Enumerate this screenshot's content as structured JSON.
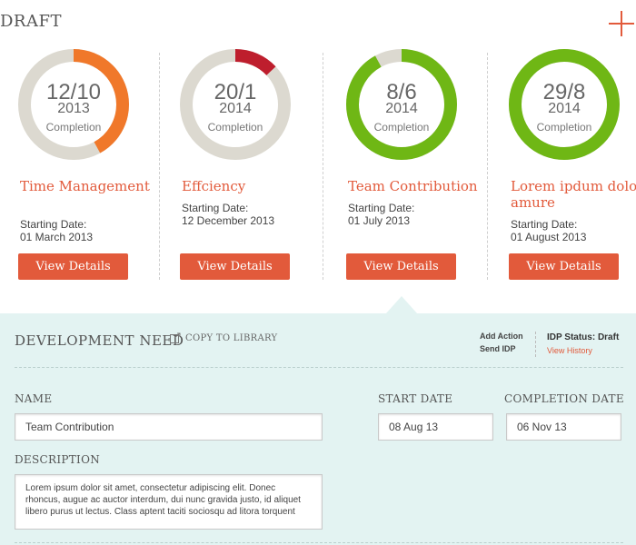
{
  "header": {
    "title": "DRAFT",
    "add_icon": "plus-icon"
  },
  "cards": [
    {
      "date": "12/10",
      "year": "2013",
      "completion_label": "Completion",
      "progress": 0.42,
      "progress_color": "#f0782a",
      "title": "Time Management",
      "start_label": "Starting Date:",
      "start_value": "01 March 2013",
      "button_label": "View Details"
    },
    {
      "date": "20/1",
      "year": "2014",
      "completion_label": "Completion",
      "progress": 0.13,
      "progress_color": "#be1e2d",
      "title": "Effciency",
      "start_label": "Starting Date:",
      "start_value": "12 December 2013",
      "button_label": "View Details"
    },
    {
      "date": "8/6",
      "year": "2014",
      "completion_label": "Completion",
      "progress": 0.92,
      "progress_color": "#6fb715",
      "title": "Team Contribution",
      "start_label": "Starting Date:",
      "start_value": "01 July 2013",
      "button_label": "View Details"
    },
    {
      "date": "29/8",
      "year": "2014",
      "completion_label": "Completion",
      "progress": 1.0,
      "progress_color": "#6fb715",
      "title": "Lorem ipdum dolor amure",
      "start_label": "Starting Date:",
      "start_value": "01 August 2013",
      "button_label": "View Details"
    }
  ],
  "colors": {
    "accent": "#e25a3b",
    "ring_track": "#dcd9d0",
    "panel_bg": "#e3f3f2"
  },
  "panel": {
    "title": "DEVELOPMENT NEED",
    "copy_label": "COPY TO LIBRARY",
    "add_action": "Add Action",
    "send_idp": "Send IDP",
    "idp_status": "IDP Status: Draft",
    "view_history": "View History",
    "name_label": "NAME",
    "name_value": "Team Contribution",
    "start_date_label": "START DATE",
    "start_date_value": "08 Aug 13",
    "completion_date_label": "COMPLETION DATE",
    "completion_date_value": "06 Nov 13",
    "description_label": "DESCRIPTION",
    "description_value": "Lorem ipsum dolor sit amet, consectetur adipiscing elit. Donec rhoncus, augue ac auctor interdum, dui nunc gravida justo, id aliquet libero purus ut lectus. Class aptent taciti sociosqu ad litora torquent"
  }
}
